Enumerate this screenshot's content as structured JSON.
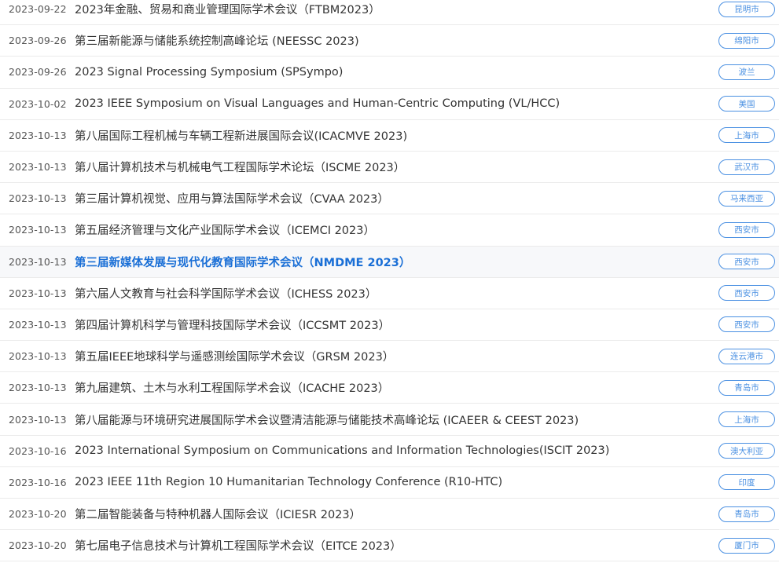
{
  "conferences": [
    {
      "date": "2023-09-22",
      "title": "2023年金融、贸易和商业管理国际学术会议（FTBM2023）",
      "location": "昆明市"
    },
    {
      "date": "2023-09-26",
      "title": "第三届新能源与储能系统控制高峰论坛 (NEESSC 2023)",
      "location": "绵阳市"
    },
    {
      "date": "2023-09-26",
      "title": "2023 Signal Processing Symposium (SPSympo)",
      "location": "波兰"
    },
    {
      "date": "2023-10-02",
      "title": "2023 IEEE Symposium on Visual Languages and Human-Centric Computing (VL/HCC)",
      "location": "美国"
    },
    {
      "date": "2023-10-13",
      "title": "第八届国际工程机械与车辆工程新进展国际会议(ICACMVE 2023)",
      "location": "上海市"
    },
    {
      "date": "2023-10-13",
      "title": "第八届计算机技术与机械电气工程国际学术论坛（ISCME 2023）",
      "location": "武汉市"
    },
    {
      "date": "2023-10-13",
      "title": "第三届计算机视觉、应用与算法国际学术会议（CVAA 2023）",
      "location": "马来西亚"
    },
    {
      "date": "2023-10-13",
      "title": "第五届经济管理与文化产业国际学术会议（ICEMCI 2023）",
      "location": "西安市"
    },
    {
      "date": "2023-10-13",
      "title": "第三届新媒体发展与现代化教育国际学术会议（NMDME 2023）",
      "location": "西安市",
      "hovered": true
    },
    {
      "date": "2023-10-13",
      "title": "第六届人文教育与社会科学国际学术会议（ICHESS 2023）",
      "location": "西安市"
    },
    {
      "date": "2023-10-13",
      "title": "第四届计算机科学与管理科技国际学术会议（ICCSMT 2023）",
      "location": "西安市"
    },
    {
      "date": "2023-10-13",
      "title": "第五届IEEE地球科学与遥感测绘国际学术会议（GRSM 2023）",
      "location": "连云港市"
    },
    {
      "date": "2023-10-13",
      "title": "第九届建筑、土木与水利工程国际学术会议（ICACHE 2023）",
      "location": "青岛市"
    },
    {
      "date": "2023-10-13",
      "title": "第八届能源与环境研究进展国际学术会议暨清洁能源与储能技术高峰论坛 (ICAEER & CEEST 2023)",
      "location": "上海市"
    },
    {
      "date": "2023-10-16",
      "title": "2023 International Symposium on Communications and Information Technologies(ISCIT 2023)",
      "location": "澳大利亚"
    },
    {
      "date": "2023-10-16",
      "title": "2023 IEEE 11th Region 10 Humanitarian Technology Conference (R10-HTC)",
      "location": "印度"
    },
    {
      "date": "2023-10-20",
      "title": "第二届智能装备与特种机器人国际会议（ICIESR 2023）",
      "location": "青岛市"
    },
    {
      "date": "2023-10-20",
      "title": "第七届电子信息技术与计算机工程国际学术会议（EITCE 2023）",
      "location": "厦门市"
    }
  ],
  "colors": {
    "accent": "#1a6fd6",
    "badge": "#4a90e2",
    "text": "#333333",
    "date": "#555555",
    "divider": "#ebebeb"
  }
}
